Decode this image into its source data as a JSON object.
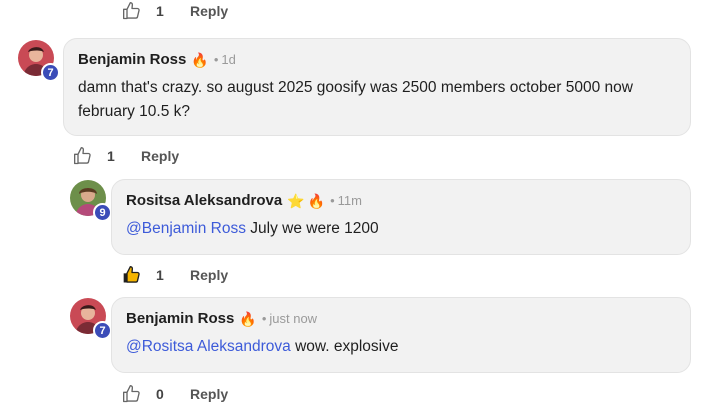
{
  "top_actions": {
    "like_count": "1",
    "reply_label": "Reply"
  },
  "comments": [
    {
      "author": "Benjamin Ross",
      "badges": [
        "🔥"
      ],
      "time": "1d",
      "level": "7",
      "mention": "",
      "text": "damn that's crazy. so august 2025 goosify was 2500 members october 5000 now february 10.5 k?",
      "like_count": "1",
      "reply_label": "Reply"
    },
    {
      "author": "Rositsa Aleksandrova",
      "badges": [
        "⭐",
        "🔥"
      ],
      "time": "11m",
      "level": "9",
      "mention": "@Benjamin Ross",
      "text": " July we were 1200",
      "like_count": "1",
      "reply_label": "Reply",
      "liked": true
    },
    {
      "author": "Benjamin Ross",
      "badges": [
        "🔥"
      ],
      "time": "just now",
      "level": "7",
      "mention": "@Rositsa Aleksandrova",
      "text": " wow. explosive",
      "like_count": "0",
      "reply_label": "Reply"
    }
  ],
  "colors": {
    "mention": "#3d5bd9",
    "badge": "#3b4cb8",
    "liked_fill": "#f4b400",
    "bubble": "#f2f2f2"
  },
  "icons": {
    "like": "thumbs-up-icon",
    "fire": "fire-emoji",
    "star": "star-emoji"
  }
}
